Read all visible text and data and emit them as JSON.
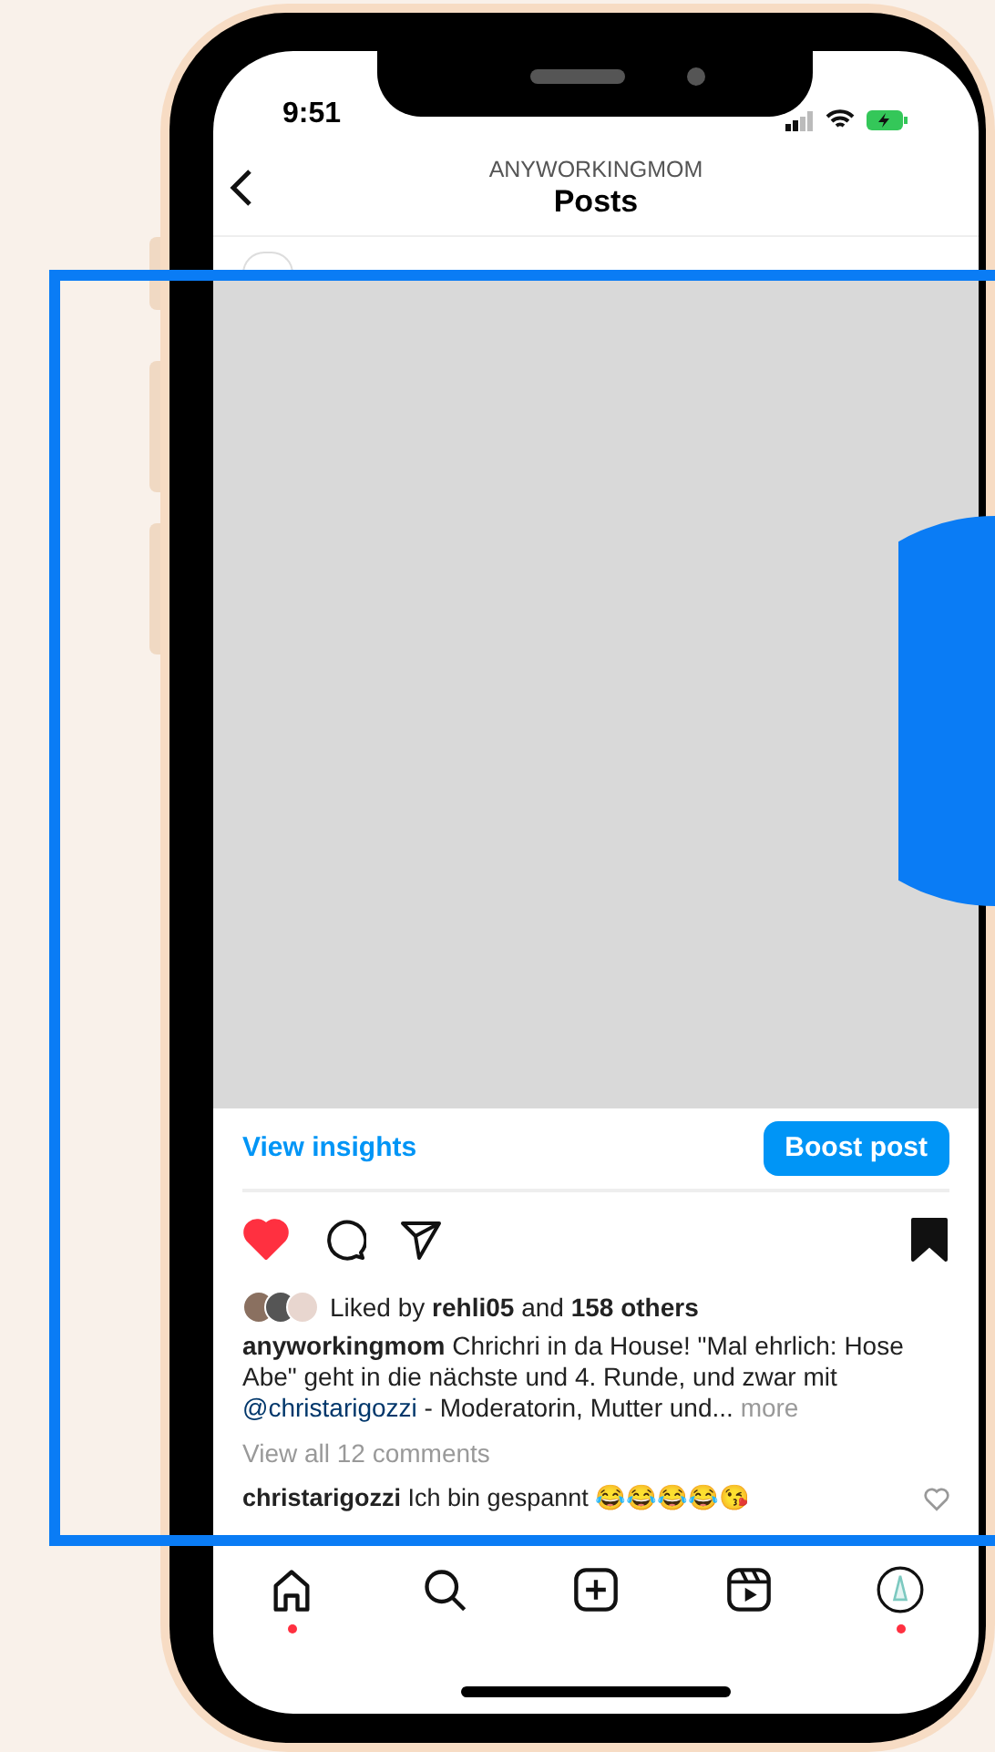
{
  "status_bar": {
    "time": "9:51"
  },
  "header": {
    "subtitle": "ANYWORKINGMOM",
    "title": "Posts"
  },
  "insights": {
    "link": "View insights",
    "button": "Boost post"
  },
  "actions": {
    "liked": true,
    "saved": true
  },
  "likes": "Liked by **rehli05** and **158 others**",
  "caption": {
    "user": "anyworkingmom",
    "text": "Chrichri in da House! \"Mal ehrlich: Hose Abe\" geht in die nächste und 4. Runde, und zwar mit",
    "mention": "@christarigozzi",
    "rest": "- Moderatorin, Mutter und...",
    "more": "more"
  },
  "view_comments": "View all 12 comments",
  "comment": {
    "user": "christarigozzi",
    "text": "Ich bin gespannt 😂😂😂😂😘",
    "liked": false
  },
  "nav": [
    {
      "kind": "home",
      "dot": true
    },
    {
      "kind": "search",
      "dot": false
    },
    {
      "kind": "create",
      "dot": false
    },
    {
      "kind": "reels",
      "dot": false
    },
    {
      "kind": "profile",
      "dot": true
    }
  ]
}
